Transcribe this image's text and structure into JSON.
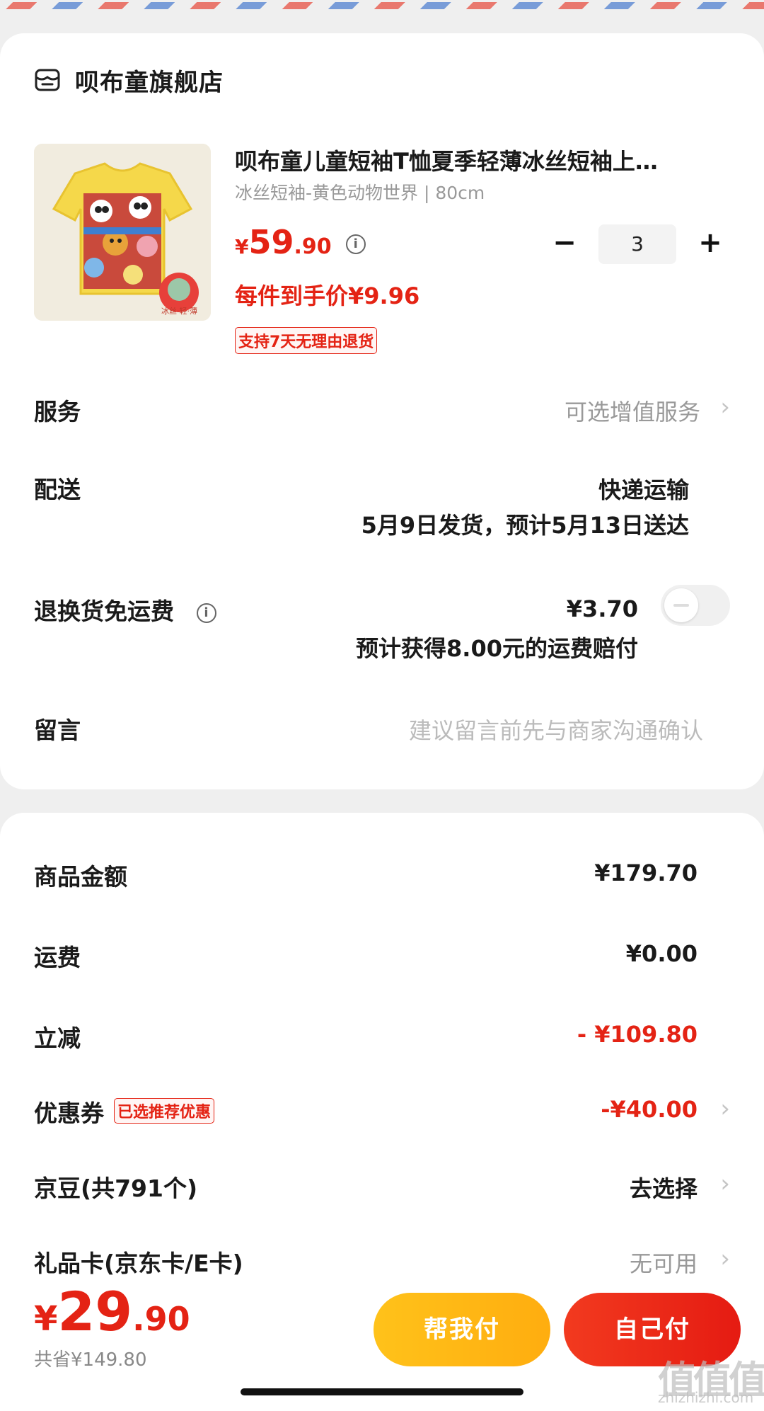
{
  "store": {
    "name": "呗布童旗舰店",
    "icon": "store-icon"
  },
  "product": {
    "title": "呗布童儿童短袖T恤夏季轻薄冰丝短袖上…",
    "spec": "冰丝短袖-黄色动物世界 | 80cm",
    "price_currency": "¥",
    "price_int": "59",
    "price_dec": ".90",
    "final_price": "每件到手价¥9.96",
    "return_tag": "支持7天无理由退货",
    "image_badge": "冰丝·轻·薄",
    "quantity": "3",
    "minus": "−",
    "plus": "+"
  },
  "rows": {
    "service": {
      "label": "服务",
      "value": "可选增值服务"
    },
    "delivery": {
      "label": "配送",
      "method": "快递运输",
      "schedule": "5月9日发货，预计5月13日送达"
    },
    "return_shipping": {
      "label": "退换货免运费",
      "price": "¥3.70",
      "note": "预计获得8.00元的运费赔付",
      "enabled": false
    },
    "message": {
      "label": "留言",
      "placeholder": "建议留言前先与商家沟通确认"
    }
  },
  "summary": {
    "goods": {
      "label": "商品金额",
      "value": "¥179.70"
    },
    "shipping": {
      "label": "运费",
      "value": "¥0.00"
    },
    "discount": {
      "label": "立减",
      "value": "- ¥109.80"
    },
    "coupon": {
      "label": "优惠券",
      "tag": "已选推荐优惠",
      "value": "-¥40.00"
    },
    "beans": {
      "label": "京豆(共791个)",
      "value": "去选择"
    },
    "giftcard": {
      "label": "礼品卡(京东卡/E卡)",
      "value": "无可用"
    }
  },
  "footer": {
    "total_currency": "¥",
    "total_int": "29",
    "total_dec": ".90",
    "saved": "共省¥149.80",
    "help_pay": "帮我付",
    "self_pay": "自己付"
  },
  "watermark": {
    "mark": "值值值",
    "domain": "zhizhizhi.com"
  },
  "colors": {
    "accent_red": "#e42314",
    "help_yellow": "#ffb714",
    "pay_red": "#ea2716"
  }
}
